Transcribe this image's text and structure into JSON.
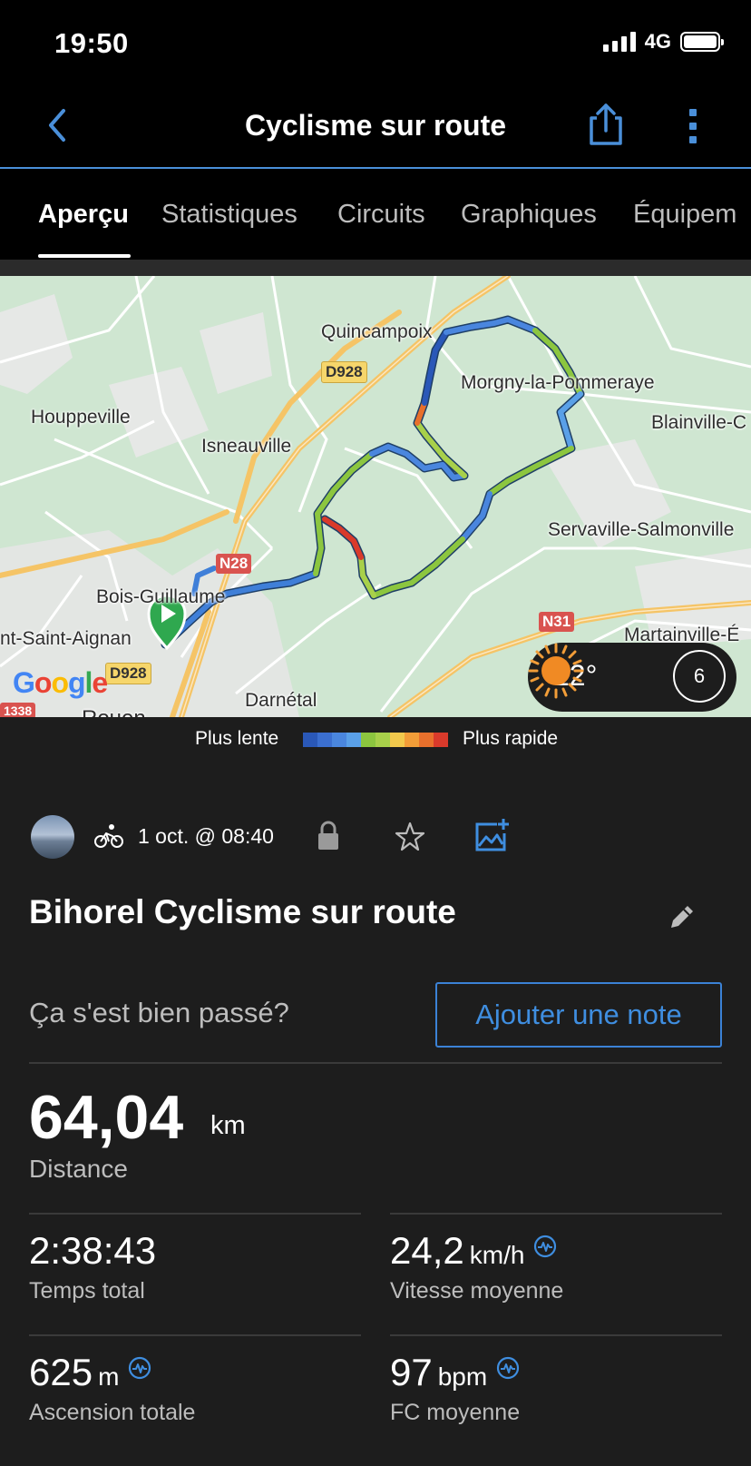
{
  "status_bar": {
    "time": "19:50",
    "network": "4G"
  },
  "nav": {
    "title": "Cyclisme sur route",
    "back_icon": "chevron-left",
    "share_icon": "share",
    "more_icon": "more-vertical",
    "accent": "#4a8fd9"
  },
  "tabs": [
    {
      "label": "Aperçu",
      "active": true
    },
    {
      "label": "Statistiques",
      "active": false
    },
    {
      "label": "Circuits",
      "active": false
    },
    {
      "label": "Graphiques",
      "active": false
    },
    {
      "label": "Équipem",
      "active": false
    }
  ],
  "map": {
    "places": [
      "Quincampoix",
      "Morgny-la-Pommeraye",
      "Houppeville",
      "Isneauville",
      "Blainville-C",
      "Servaville-Salmonville",
      "Bois-Guillaume",
      "nt-Saint-Aignan",
      "Martainville-É",
      "Darnétal",
      "Rouen"
    ],
    "roads": [
      "D928",
      "N28",
      "N31",
      "D928",
      "1338"
    ],
    "attribution": "Google",
    "weather": {
      "temperature": "12°",
      "icon": "sun",
      "wind": "6"
    }
  },
  "legend": {
    "slow": "Plus lente",
    "fast": "Plus rapide",
    "colors": [
      "#2a58b8",
      "#3b6fd0",
      "#4a86de",
      "#5aa0e8",
      "#8cc63f",
      "#a8d04a",
      "#f2c94c",
      "#f29d38",
      "#e8702c",
      "#d93a2b"
    ]
  },
  "activity": {
    "date": "1 oct. @ 08:40",
    "title": "Bihorel Cyclisme sur route",
    "question": "Ça s'est bien passé?",
    "add_note": "Ajouter une note"
  },
  "stats": {
    "distance": {
      "value": "64,04",
      "unit": "km",
      "label": "Distance"
    },
    "total_time": {
      "value": "2:38:43",
      "unit": "",
      "label": "Temps total"
    },
    "avg_speed": {
      "value": "24,2",
      "unit": "km/h",
      "label": "Vitesse moyenne"
    },
    "ascent": {
      "value": "625",
      "unit": "m",
      "label": "Ascension totale"
    },
    "avg_hr": {
      "value": "97",
      "unit": "bpm",
      "label": "FC moyenne"
    }
  }
}
